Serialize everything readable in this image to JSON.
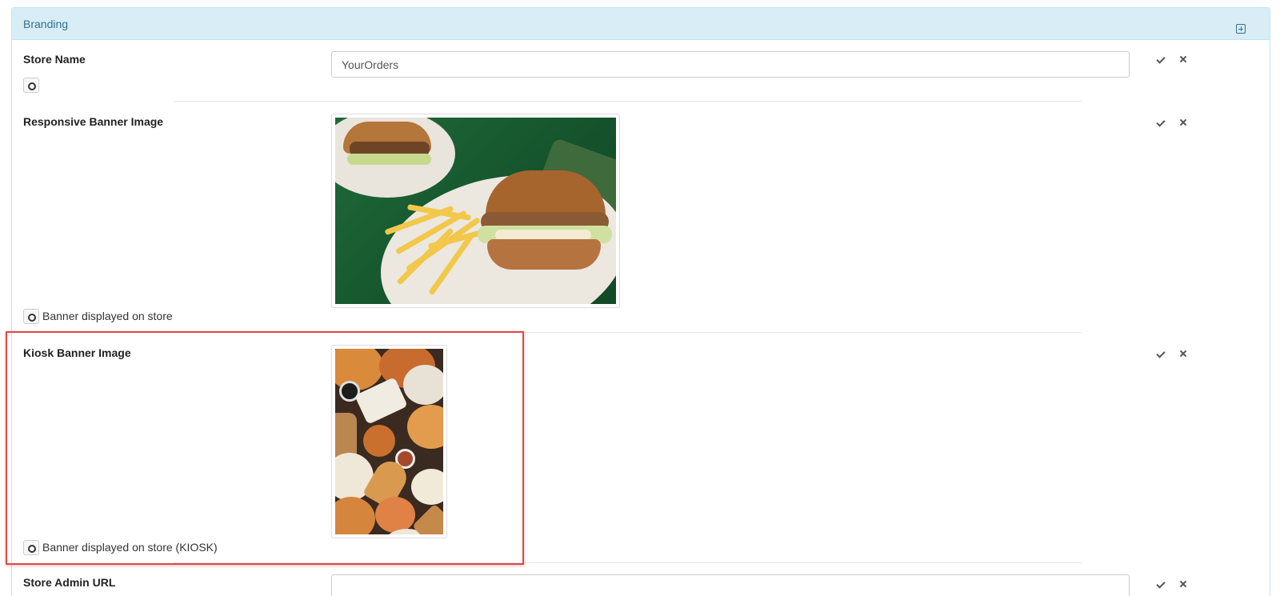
{
  "panel": {
    "title": "Branding"
  },
  "fields": {
    "store_name": {
      "label": "Store Name",
      "value": "YourOrders"
    },
    "responsive_banner": {
      "label": "Responsive Banner Image",
      "help": "Banner displayed on store"
    },
    "kiosk_banner": {
      "label": "Kiosk Banner Image",
      "help": "Banner displayed on store (KIOSK)"
    },
    "store_admin_url": {
      "label": "Store Admin URL",
      "value": ""
    }
  },
  "icons": {
    "expand": "plus-square-icon",
    "help": "help-circle-icon",
    "confirm": "check-icon",
    "cancel": "close-icon"
  },
  "colors": {
    "panel_heading_bg": "#d9edf7",
    "panel_border": "#bce8f1",
    "panel_title": "#31708f",
    "highlight": "#e04848"
  }
}
